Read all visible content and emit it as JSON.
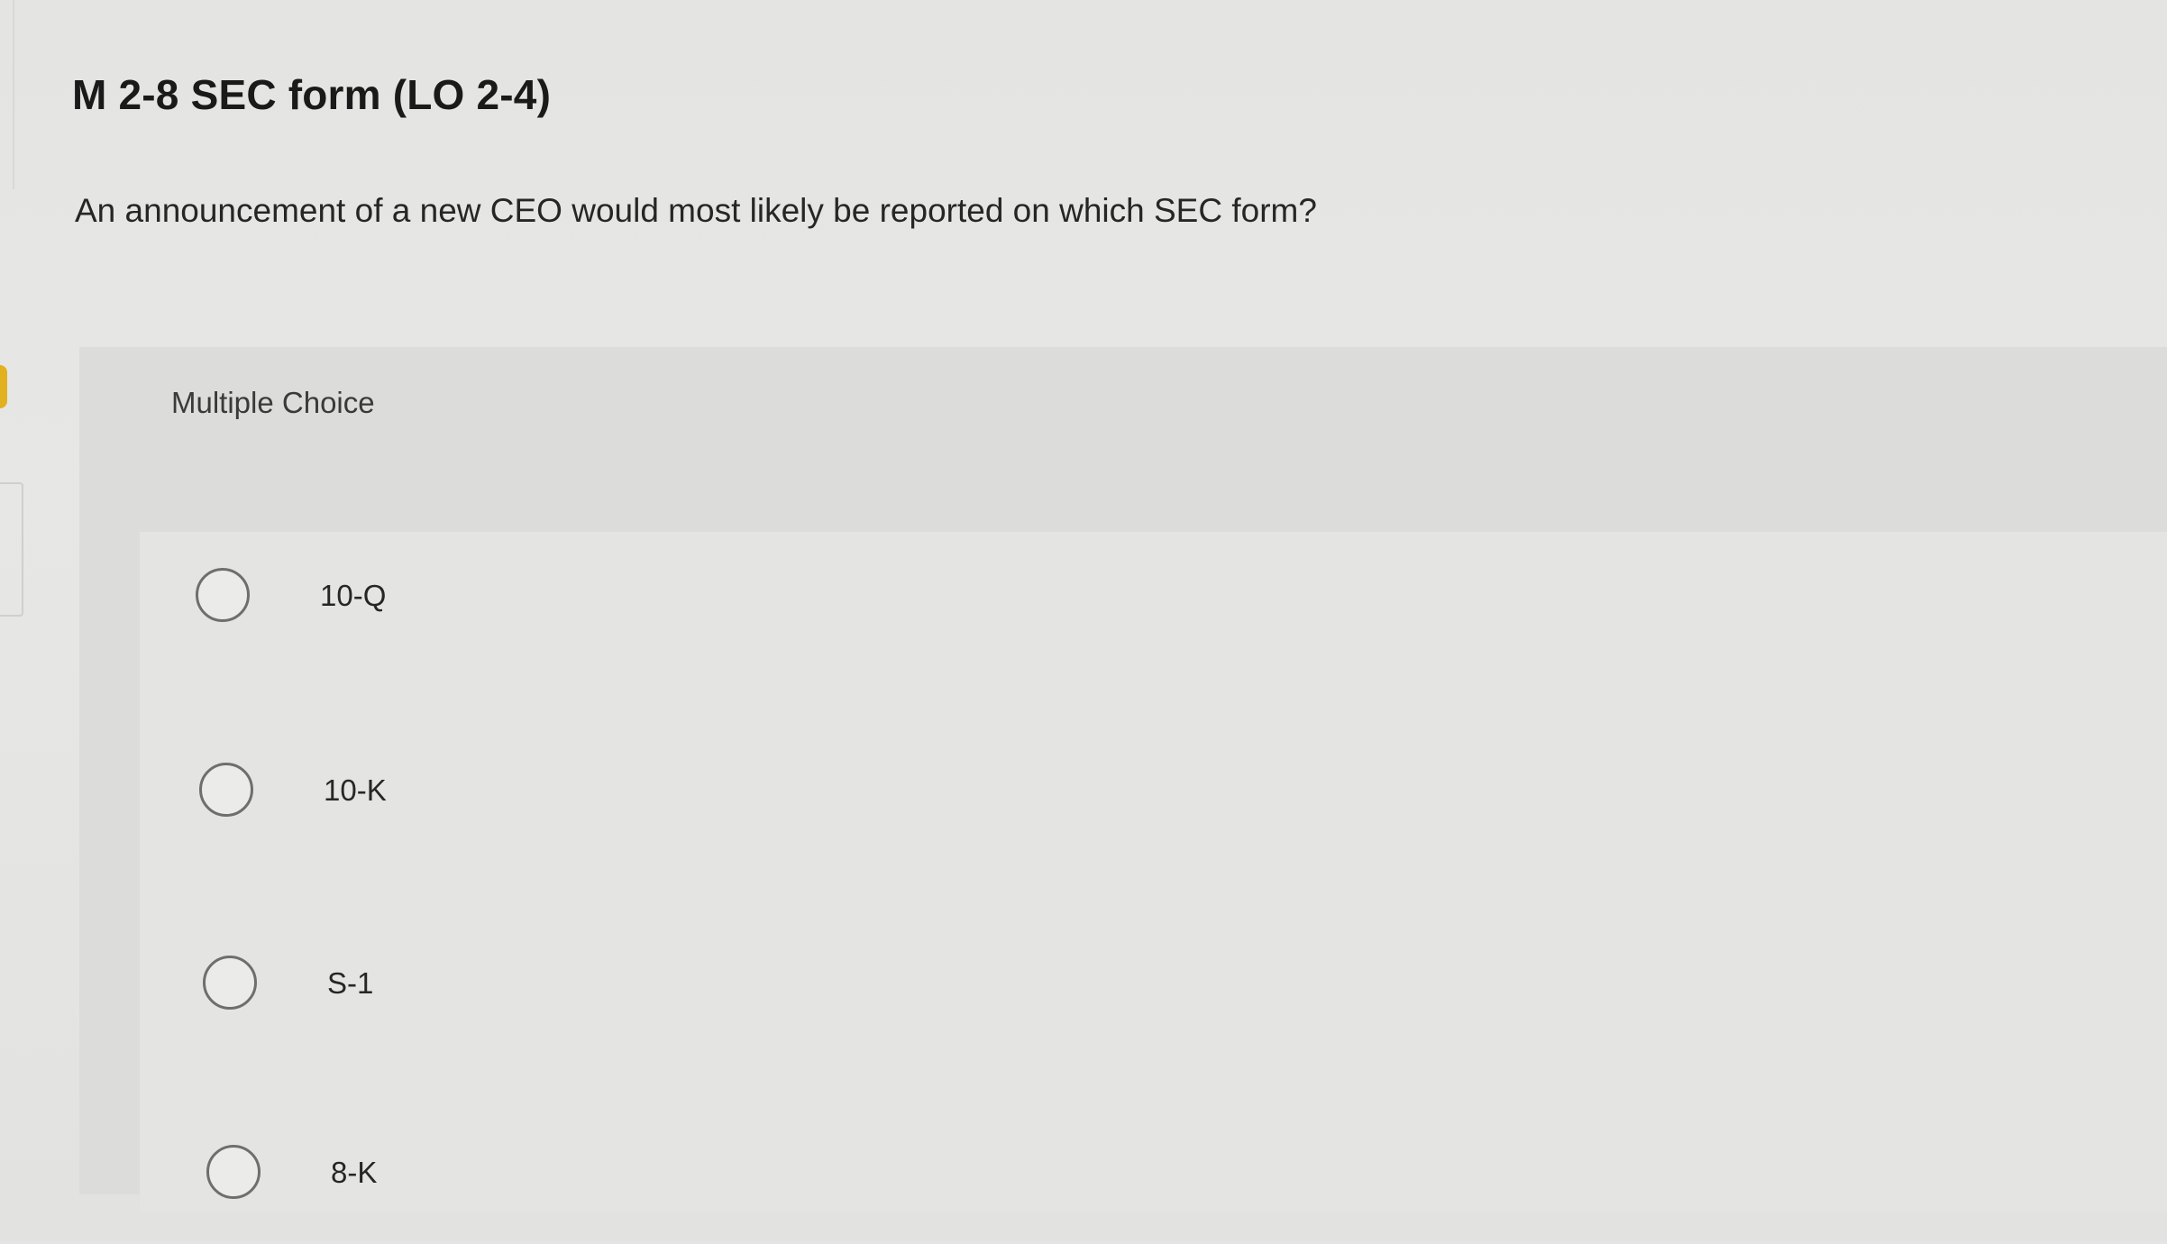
{
  "question": {
    "title": "M 2-8 SEC form (LO 2-4)",
    "prompt": "An announcement of a new CEO would most likely be reported on which SEC form?"
  },
  "answer_section": {
    "type_label": "Multiple Choice",
    "options": [
      {
        "label": "10-Q",
        "selected": false
      },
      {
        "label": "10-K",
        "selected": false
      },
      {
        "label": "S-1",
        "selected": false
      },
      {
        "label": "8-K",
        "selected": false
      }
    ]
  },
  "colors": {
    "page_background": "#e4e4e2",
    "panel_background": "#dcdcda",
    "radio_border": "#6e6e6e",
    "indicator": "#e2b11f"
  }
}
